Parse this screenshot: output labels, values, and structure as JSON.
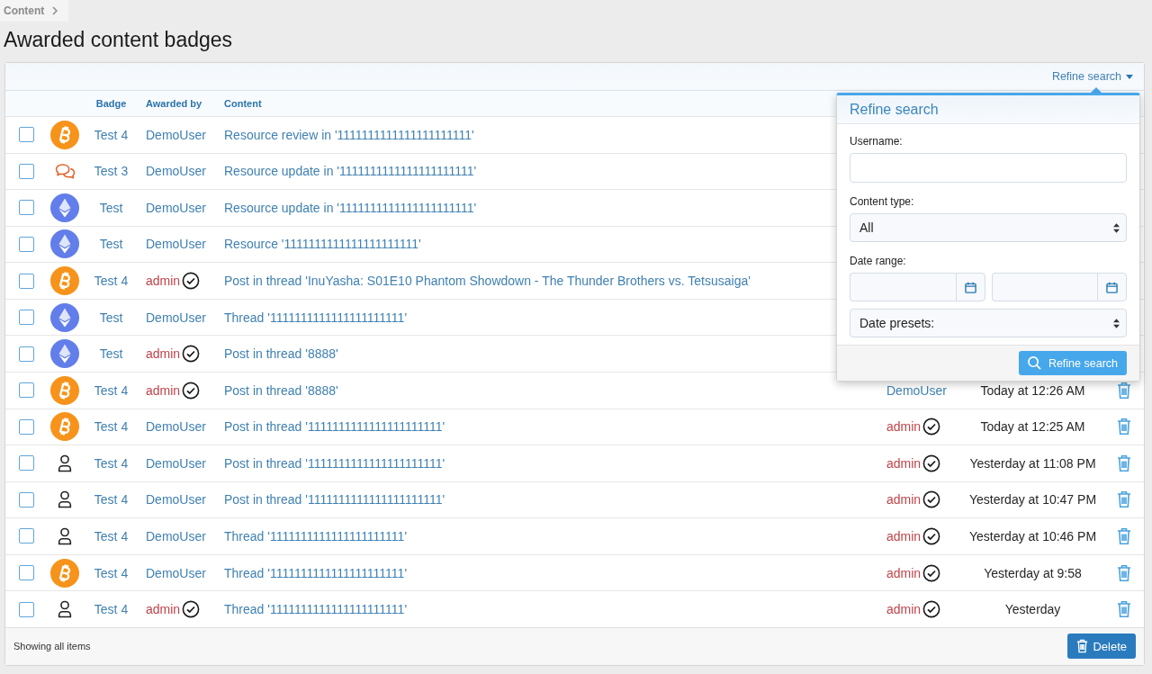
{
  "breadcrumb": {
    "label": "Content"
  },
  "page_title": "Awarded content badges",
  "toolbar": {
    "refine_search": {
      "label": "Refine search",
      "expanded": true
    }
  },
  "refine_popup": {
    "title": "Refine search",
    "fields": [
      {
        "kind": "text",
        "label": "Username:"
      },
      {
        "kind": "select",
        "label": "Content type:",
        "value": "All"
      },
      {
        "kind": "date-range",
        "label": "Date range:"
      },
      {
        "kind": "select",
        "value": "Date presets:"
      }
    ],
    "submit": "Refine search"
  },
  "table": {
    "columns": [
      "Badge",
      "Awarded by",
      "Content"
    ],
    "rows": [
      {
        "checked": false,
        "badge": {
          "kind": "b-coin",
          "name": "Test 4"
        },
        "awarded_by": {
          "name": "DemoUser",
          "staff": false
        },
        "content": "Resource review in '1111111111111111111111'"
      },
      {
        "checked": false,
        "badge": {
          "kind": "chat",
          "name": "Test 3"
        },
        "awarded_by": {
          "name": "DemoUser",
          "staff": false
        },
        "content": "Resource update in '1111111111111111111111'"
      },
      {
        "checked": false,
        "badge": {
          "kind": "diamond-coin",
          "name": "Test"
        },
        "awarded_by": {
          "name": "DemoUser",
          "staff": false
        },
        "content": "Resource update in '1111111111111111111111'"
      },
      {
        "checked": false,
        "badge": {
          "kind": "diamond-coin",
          "name": "Test"
        },
        "awarded_by": {
          "name": "DemoUser",
          "staff": false
        },
        "content": "Resource '1111111111111111111111'"
      },
      {
        "checked": false,
        "badge": {
          "kind": "b-coin",
          "name": "Test 4"
        },
        "awarded_by": {
          "name": "admin",
          "staff": true
        },
        "content": "Post in thread 'InuYasha: S01E10 Phantom Showdown - The Thunder Brothers vs. Tetsusaiga'"
      },
      {
        "checked": false,
        "badge": {
          "kind": "diamond-coin",
          "name": "Test"
        },
        "awarded_by": {
          "name": "DemoUser",
          "staff": false
        },
        "content": "Thread '1111111111111111111111'"
      },
      {
        "checked": false,
        "badge": {
          "kind": "diamond-coin",
          "name": "Test"
        },
        "awarded_by": {
          "name": "admin",
          "staff": true
        },
        "content": "Post in thread '8888'"
      },
      {
        "checked": false,
        "badge": {
          "kind": "b-coin",
          "name": "Test 4"
        },
        "awarded_by": {
          "name": "admin",
          "staff": true
        },
        "content": "Post in thread '8888'",
        "awarded_to": {
          "name": "DemoUser",
          "staff": false
        },
        "date": "Today at 12:26 AM"
      },
      {
        "checked": false,
        "badge": {
          "kind": "b-coin",
          "name": "Test 4"
        },
        "awarded_by": {
          "name": "DemoUser",
          "staff": false
        },
        "content": "Post in thread '1111111111111111111111'",
        "awarded_to": {
          "name": "admin",
          "staff": true
        },
        "date": "Today at 12:25 AM"
      },
      {
        "checked": false,
        "badge": {
          "kind": "user",
          "name": "Test 4"
        },
        "awarded_by": {
          "name": "DemoUser",
          "staff": false
        },
        "content": "Post in thread '1111111111111111111111'",
        "awarded_to": {
          "name": "admin",
          "staff": true
        },
        "date": "Yesterday at 11:08 PM"
      },
      {
        "checked": false,
        "badge": {
          "kind": "user",
          "name": "Test 4"
        },
        "awarded_by": {
          "name": "DemoUser",
          "staff": false
        },
        "content": "Post in thread '1111111111111111111111'",
        "awarded_to": {
          "name": "admin",
          "staff": true
        },
        "date": "Yesterday at 10:47 PM"
      },
      {
        "checked": false,
        "badge": {
          "kind": "user",
          "name": "Test 4"
        },
        "awarded_by": {
          "name": "DemoUser",
          "staff": false
        },
        "content": "Thread '1111111111111111111111'",
        "awarded_to": {
          "name": "admin",
          "staff": true
        },
        "date": "Yesterday at 10:46 PM"
      },
      {
        "checked": false,
        "badge": {
          "kind": "b-coin",
          "name": "Test 4"
        },
        "awarded_by": {
          "name": "DemoUser",
          "staff": false
        },
        "content": "Thread '1111111111111111111111'",
        "awarded_to": {
          "name": "admin",
          "staff": true
        },
        "date": "Yesterday at 9:58"
      },
      {
        "checked": false,
        "badge": {
          "kind": "user",
          "name": "Test 4"
        },
        "awarded_by": {
          "name": "admin",
          "staff": true
        },
        "content": "Thread '1111111111111111111111'",
        "awarded_to": {
          "name": "admin",
          "staff": true
        },
        "date": "Yesterday"
      }
    ]
  },
  "footer": {
    "status": "Showing all items",
    "delete_button": "Delete"
  }
}
